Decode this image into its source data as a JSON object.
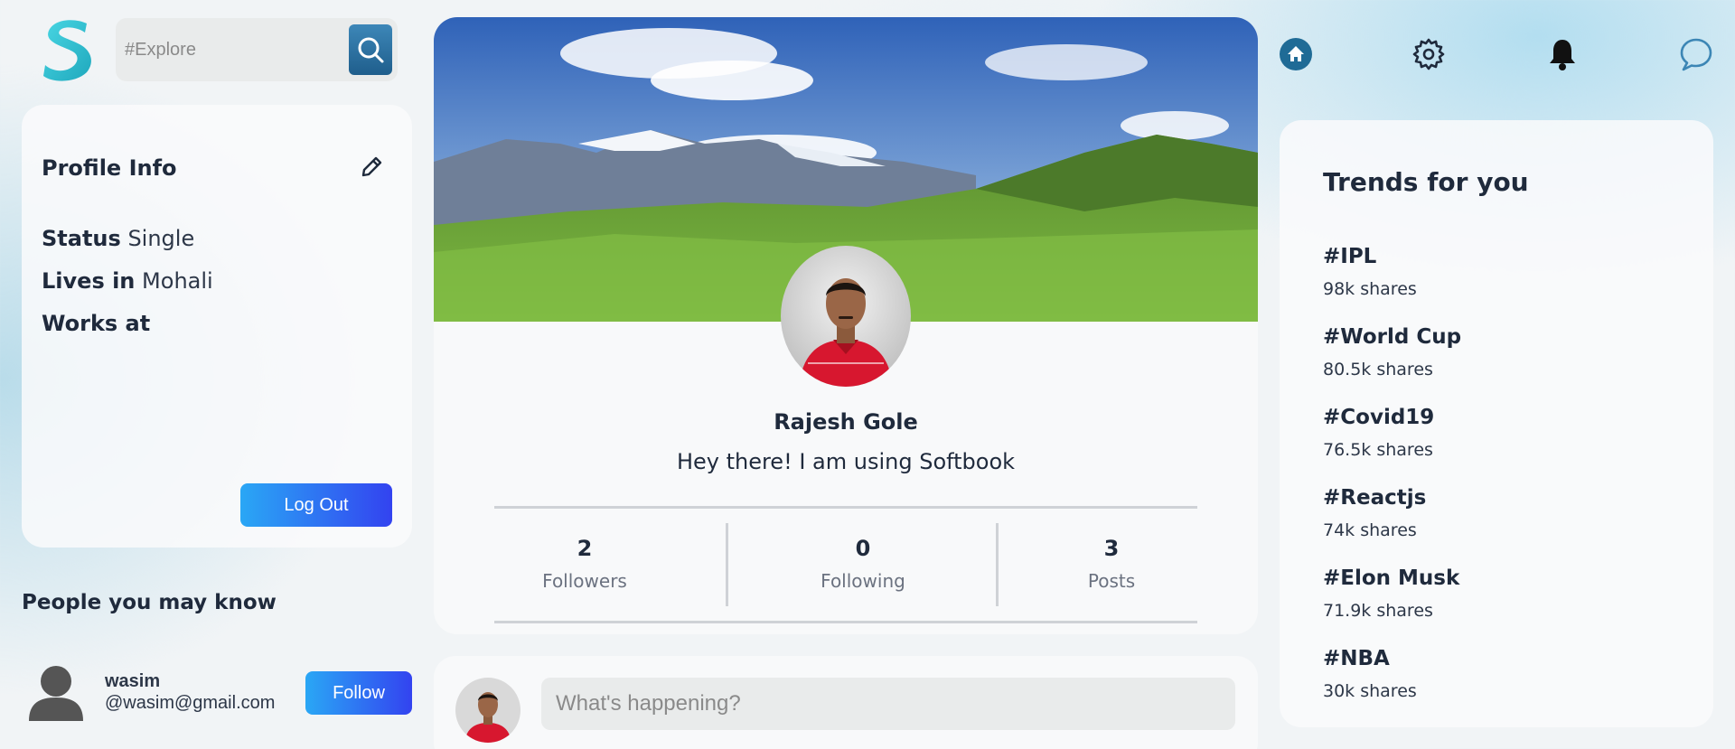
{
  "search": {
    "placeholder": "#Explore"
  },
  "profile_info": {
    "title": "Profile Info",
    "status_label": "Status",
    "status_value": "Single",
    "lives_label": "Lives in",
    "lives_value": "Mohali",
    "works_label": "Works at",
    "works_value": "",
    "logout_label": "Log Out"
  },
  "people": {
    "title": "People you may know",
    "items": [
      {
        "name": "wasim",
        "email": "@wasim@gmail.com",
        "follow_label": "Follow"
      }
    ]
  },
  "profile": {
    "name": "Rajesh Gole",
    "bio": "Hey there! I am using Softbook",
    "stats": [
      {
        "value": "2",
        "label": "Followers"
      },
      {
        "value": "0",
        "label": "Following"
      },
      {
        "value": "3",
        "label": "Posts"
      }
    ]
  },
  "post": {
    "placeholder": "What's happening?"
  },
  "nav": {
    "icons": [
      "home-icon",
      "gear-icon",
      "bell-icon",
      "chat-icon"
    ]
  },
  "trends": {
    "title": "Trends for you",
    "items": [
      {
        "tag": "#IPL",
        "shares": "98k shares"
      },
      {
        "tag": "#World Cup",
        "shares": "80.5k shares"
      },
      {
        "tag": "#Covid19",
        "shares": "76.5k shares"
      },
      {
        "tag": "#Reactjs",
        "shares": "74k shares"
      },
      {
        "tag": "#Elon Musk",
        "shares": "71.9k shares"
      },
      {
        "tag": "#NBA",
        "shares": "30k shares"
      }
    ]
  },
  "colors": {
    "accent_start": "#2aa7f5",
    "accent_end": "#3343f0",
    "text_dark": "#1f2a3c",
    "logo": "#2ec4d6"
  }
}
